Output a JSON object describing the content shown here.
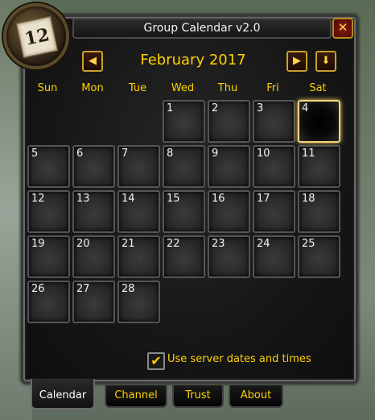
{
  "window": {
    "title": "Group Calendar v2.0",
    "close_label": "✕"
  },
  "portrait": {
    "text": "12"
  },
  "nav": {
    "prev_label": "◀",
    "next_label": "▶",
    "today_label": "⬇",
    "month_title": "February 2017"
  },
  "weekdays": [
    "Sun",
    "Mon",
    "Tue",
    "Wed",
    "Thu",
    "Fri",
    "Sat"
  ],
  "days": [
    "1",
    "2",
    "3",
    "4",
    "5",
    "6",
    "7",
    "8",
    "9",
    "10",
    "11",
    "12",
    "13",
    "14",
    "15",
    "16",
    "17",
    "18",
    "19",
    "20",
    "21",
    "22",
    "23",
    "24",
    "25",
    "26",
    "27",
    "28"
  ],
  "options": {
    "check_mark": "✔",
    "server_dates_label": "Use server dates and times",
    "server_dates_checked": true
  },
  "tabs": [
    {
      "label": "Calendar",
      "active": true
    },
    {
      "label": "Channel",
      "active": false
    },
    {
      "label": "Trust",
      "active": false
    },
    {
      "label": "About",
      "active": false
    }
  ],
  "colors": {
    "accent": "#ffd100",
    "today_border": "#f1d47c"
  },
  "icons": {
    "close": "close-icon",
    "prev": "arrow-left-icon",
    "next": "arrow-right-icon",
    "today": "arrow-down-icon"
  }
}
